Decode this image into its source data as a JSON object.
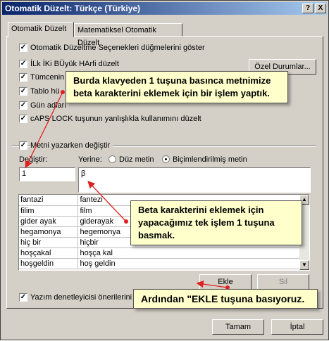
{
  "window": {
    "title": "Otomatik Düzelt: Türkçe (Türkiye)",
    "help_btn": "?",
    "close_btn": "X"
  },
  "tabs": [
    {
      "label": "Otomatik Düzelt"
    },
    {
      "label": "Matematiksel Otomatik Düzelt"
    }
  ],
  "options": {
    "show_buttons": "Otomatik Düzeltme Seçenekleri düğmelerini göster",
    "two_initials": "İLk İKi BÜyük HArfi düzelt",
    "sentence_first": "Tümcenin",
    "table_cells": "Tablo hü",
    "day_names": "Gün adları",
    "caps_lock": "cAPS LOCK tuşunun yanlışlıkla kullanımını düzelt",
    "replace_as_type": "Metni yazarken değiştir"
  },
  "exceptions_button": "Özel Durumlar...",
  "replace_label": "Değiştir:",
  "with_label": "Yerine:",
  "radio_plain": "Düz metin",
  "radio_formatted": "Biçimlendirilmiş metin",
  "replace_value": "1",
  "with_value": "β",
  "list_rows": [
    [
      "fantazi",
      "fantezi"
    ],
    [
      "filim",
      "film"
    ],
    [
      "gider ayak",
      "giderayak"
    ],
    [
      "hegamonya",
      "hegemonya"
    ],
    [
      "hiç bir",
      "hiçbir"
    ],
    [
      "hoşçakal",
      "hoşça kal"
    ],
    [
      "hoşgeldin",
      "hoş geldin"
    ]
  ],
  "add_button": "Ekle",
  "delete_button": "Sil",
  "spellcheck_option": "Yazım denetleyicisi önerilerini o",
  "ok_button": "Tamam",
  "cancel_button": "İptal",
  "callouts": {
    "top": "Burda klavyeden 1 tuşuna basınca metnimize beta karakterini eklemek için bir işlem yaptık.",
    "middle": "Beta karakterini eklemek için yapacağımız tek işlem 1 tuşuna basmak.",
    "bottom": "Ardından \"EKLE tuşuna basıyoruz."
  },
  "colors": {
    "callout_bg": "#ffffcc",
    "arrow": "#e02020",
    "title_start": "#0a246a",
    "title_end": "#a6caf0"
  }
}
